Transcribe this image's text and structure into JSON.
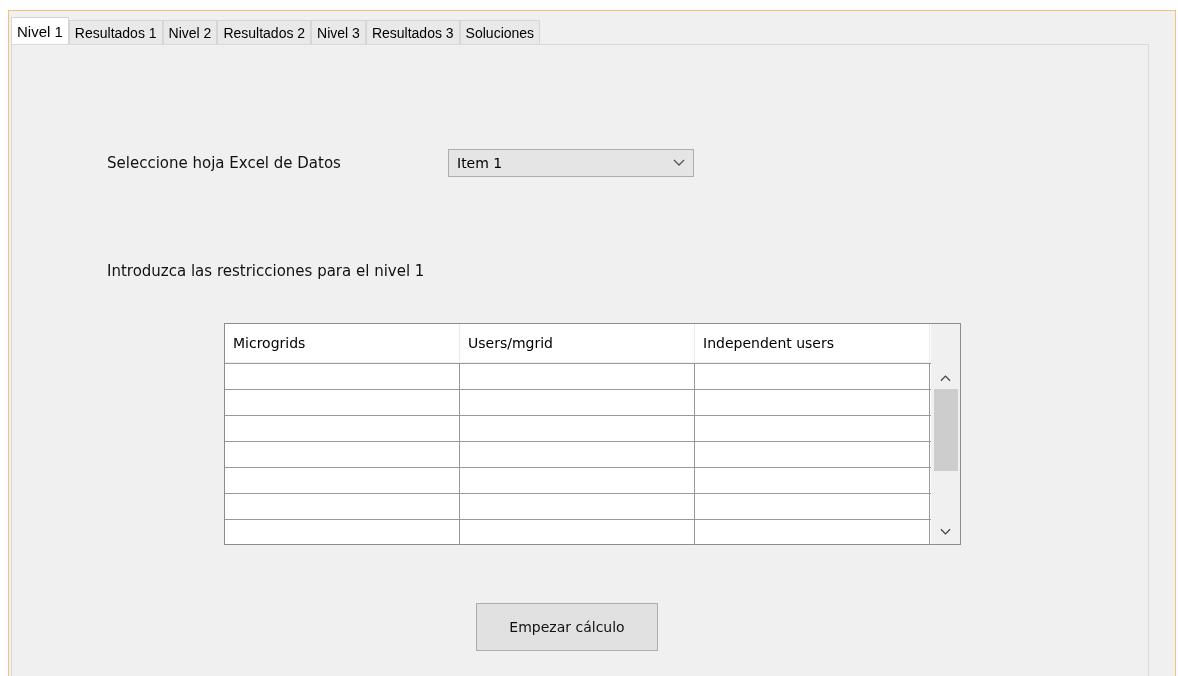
{
  "tabs": [
    {
      "label": "Nivel 1",
      "selected": true
    },
    {
      "label": "Resultados 1",
      "selected": false
    },
    {
      "label": "Nivel 2",
      "selected": false
    },
    {
      "label": "Resultados 2",
      "selected": false
    },
    {
      "label": "Nivel 3",
      "selected": false
    },
    {
      "label": "Resultados 3",
      "selected": false
    },
    {
      "label": "Soluciones",
      "selected": false
    }
  ],
  "sheet_label": "Seleccione hoja Excel de Datos",
  "sheet_combo": {
    "value": "Item 1"
  },
  "restrictions_label": "Introduzca las restricciones para el nivel 1",
  "table": {
    "columns": [
      "Microgrids",
      "Users/mgrid",
      "Independent users"
    ]
  },
  "start_button": "Empezar cálculo"
}
